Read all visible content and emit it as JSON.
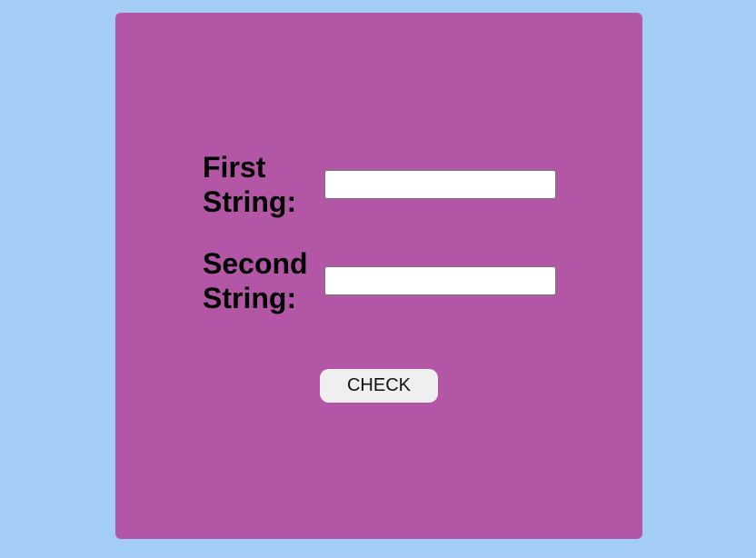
{
  "form": {
    "first_label": "First String:",
    "first_value": "",
    "first_placeholder": "",
    "second_label": "Second String:",
    "second_value": "",
    "second_placeholder": "",
    "check_label": "CHECK"
  },
  "colors": {
    "page_background": "#a3cdf4",
    "card_background": "#b356a6",
    "button_background": "#efefef"
  }
}
